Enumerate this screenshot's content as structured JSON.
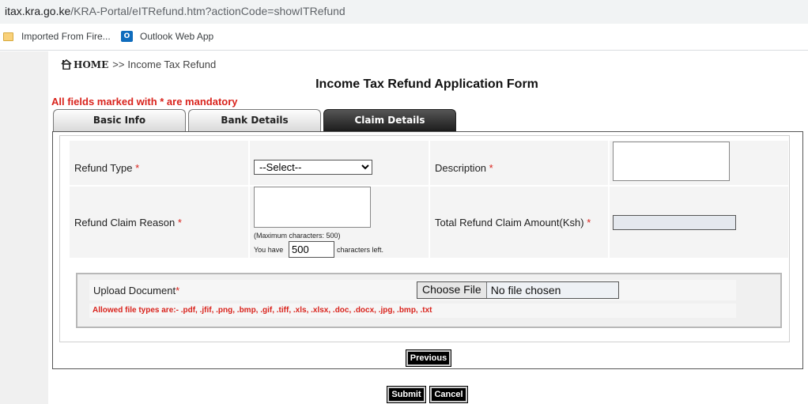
{
  "browser": {
    "url_domain": "itax.kra.go.ke",
    "url_path": "/KRA-Portal/eITRefund.htm?actionCode=showITRefund",
    "bookmarks": [
      {
        "label": "Imported From Fire...",
        "icon": "folder-icon"
      },
      {
        "label": "Outlook Web App",
        "icon": "outlook-icon"
      }
    ],
    "outlook_icon_glyph": "O"
  },
  "breadcrumb": {
    "home": "HOME",
    "separator": ">>",
    "current": "Income Tax Refund"
  },
  "page": {
    "title": "Income Tax Refund Application Form",
    "mandatory_note": "All fields marked with * are mandatory"
  },
  "tabs": [
    {
      "label": "Basic Info",
      "active": false
    },
    {
      "label": "Bank Details",
      "active": false
    },
    {
      "label": "Claim Details",
      "active": true
    }
  ],
  "form": {
    "required_mark": "*",
    "refund_type": {
      "label": "Refund Type",
      "selected": "--Select--"
    },
    "description": {
      "label": "Description",
      "value": ""
    },
    "claim_reason": {
      "label": "Refund Claim Reason",
      "value": "",
      "max_note": "(Maximum characters: 500)",
      "you_have": "You have",
      "chars_left_value": "500",
      "chars_left_suffix": "characters left."
    },
    "total_amount": {
      "label": "Total Refund Claim Amount(Ksh)",
      "value": ""
    },
    "upload": {
      "label": "Upload Document",
      "choose_file": "Choose File",
      "no_file": "No file chosen",
      "allowed_types": "Allowed file types are:- .pdf, .jfif, .png, .bmp, .gif, .tiff, .xls, .xlsx, .doc, .docx, .jpg, .bmp, .txt"
    }
  },
  "buttons": {
    "previous": "Previous",
    "submit": "Submit",
    "cancel": "Cancel"
  },
  "colors": {
    "required": "#d9231c",
    "active_tab": "#1a1a1a",
    "button_bg": "#000000"
  }
}
